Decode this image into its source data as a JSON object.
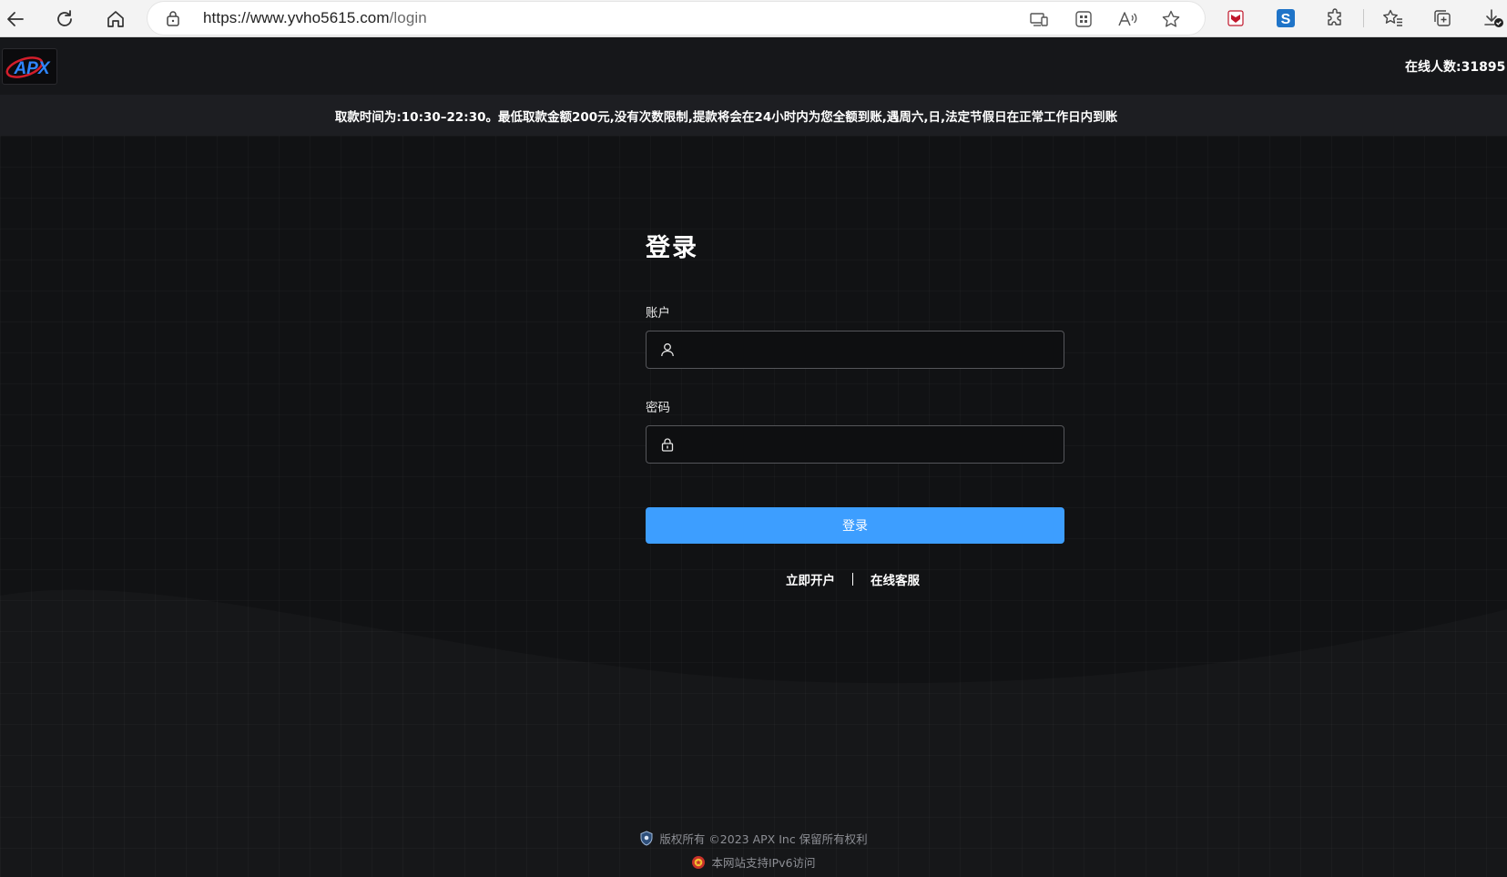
{
  "browser": {
    "url_host": "https://www.yvho5615.com",
    "url_path": "/login"
  },
  "header": {
    "logo_text": "APX",
    "online_label": "在线人数:",
    "online_count": "31895"
  },
  "notice": {
    "text": "取款时间为:10:30–22:30。最低取款金额200元,没有次数限制,提款将会在24小时内为您全额到账,遇周六,日,法定节假日在正常工作日内到账"
  },
  "login": {
    "title": "登录",
    "account_label": "账户",
    "account_value": "",
    "password_label": "密码",
    "password_value": "",
    "submit_label": "登录",
    "register_link": "立即开户",
    "support_link": "在线客服"
  },
  "footer": {
    "copyright": "版权所有 ©2023 APX Inc 保留所有权利",
    "ipv6": "本网站支持IPv6访问"
  },
  "colors": {
    "accent": "#3d9eff",
    "background": "#111214",
    "header": "#16171a",
    "notice": "#1d1e22"
  },
  "icons": [
    "back-icon",
    "refresh-icon",
    "home-icon",
    "lock-icon",
    "app-available-icon",
    "apps-icon",
    "read-aloud-icon",
    "favorite-star-icon",
    "mcafee-icon",
    "s-extension-icon",
    "extensions-icon",
    "favorites-icon",
    "collections-icon",
    "downloads-icon",
    "user-icon",
    "password-lock-icon",
    "shield-badge-icon",
    "police-emblem-icon"
  ]
}
